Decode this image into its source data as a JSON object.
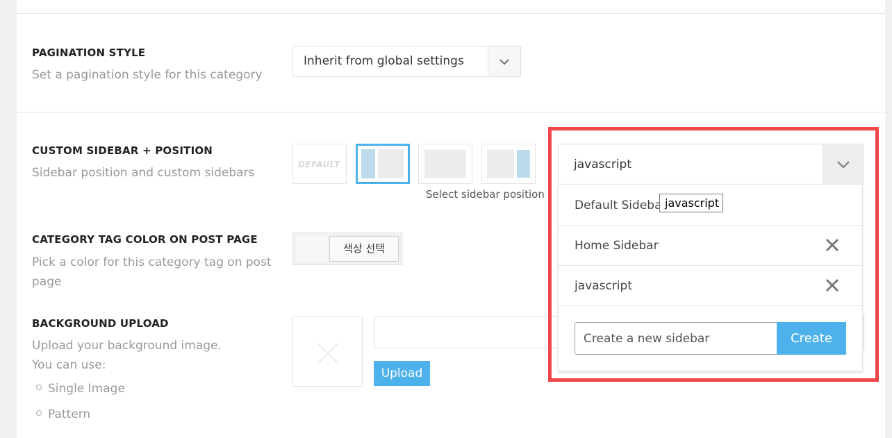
{
  "pagination": {
    "title": "PAGINATION STYLE",
    "desc": "Set a pagination style for this category",
    "selected": "Inherit from global settings"
  },
  "sidebar": {
    "title": "CUSTOM SIDEBAR + POSITION",
    "desc": "Sidebar position and custom sidebars",
    "default_label": "DEFAULT",
    "position_label": "Select sidebar position",
    "selected": "javascript",
    "options": [
      {
        "label": "Default Sidebar"
      },
      {
        "label": "Home Sidebar"
      },
      {
        "label": "javascript"
      }
    ],
    "tooltip": "javascript",
    "new_placeholder": "Create a new sidebar",
    "create_label": "Create"
  },
  "tag_color": {
    "title": "CATEGORY TAG COLOR ON POST PAGE",
    "desc": "Pick a color for this category tag on post page",
    "button_label": "색상 선택"
  },
  "background": {
    "title": "BACKGROUND UPLOAD",
    "desc_line1": "Upload your background image.",
    "desc_line2": "You can use:",
    "options": [
      "Single Image",
      "Pattern"
    ],
    "upload_label": "Upload"
  },
  "colors": {
    "accent": "#4db2ec",
    "highlight": "#f0474a"
  }
}
